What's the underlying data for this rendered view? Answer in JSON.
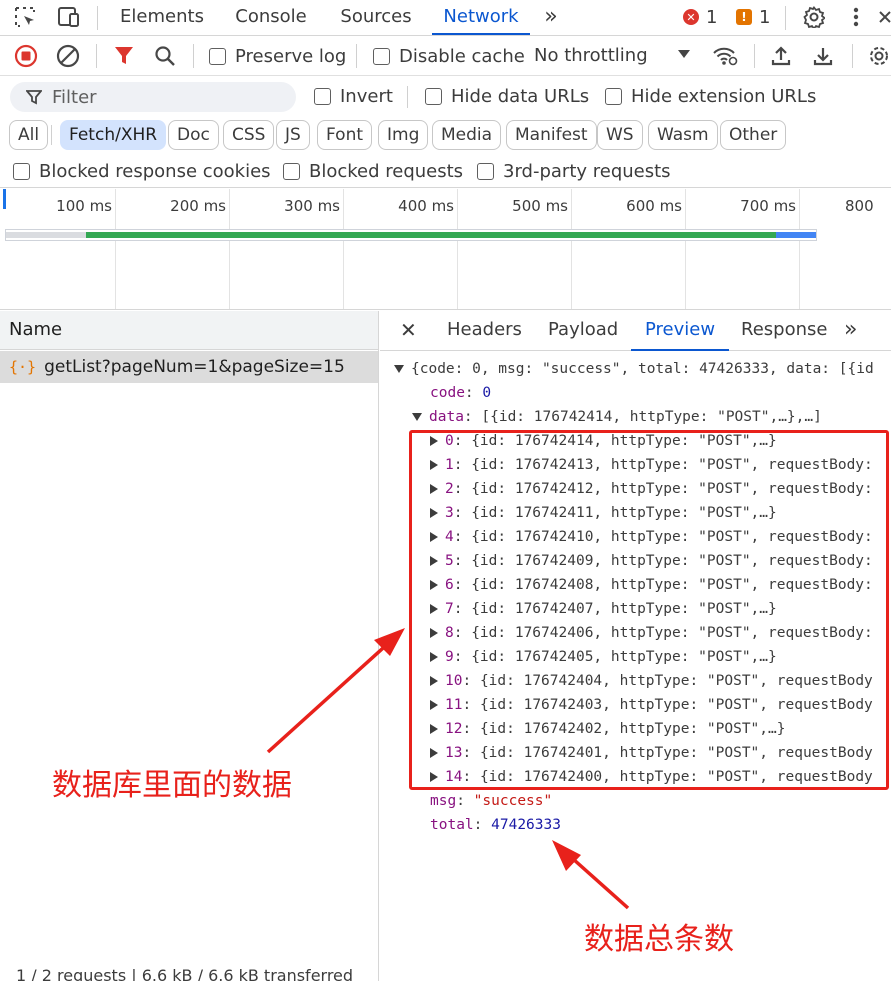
{
  "tabbar": {
    "tabs": [
      "Elements",
      "Console",
      "Sources",
      "Network"
    ],
    "active_tab": "Network",
    "more": "»",
    "errors": "1",
    "warnings": "1"
  },
  "toolbar": {
    "preserve_log": "Preserve log",
    "disable_cache": "Disable cache",
    "throttling": "No throttling"
  },
  "filter": {
    "placeholder": "Filter",
    "invert": "Invert",
    "hide_data_urls": "Hide data URLs",
    "hide_extension_urls": "Hide extension URLs"
  },
  "type_filters": [
    "All",
    "Fetch/XHR",
    "Doc",
    "CSS",
    "JS",
    "Font",
    "Img",
    "Media",
    "Manifest",
    "WS",
    "Wasm",
    "Other"
  ],
  "active_type": "Fetch/XHR",
  "blocked": {
    "cookies": "Blocked response cookies",
    "requests": "Blocked requests",
    "third_party": "3rd-party requests"
  },
  "timeline": {
    "ticks": [
      "100 ms",
      "200 ms",
      "300 ms",
      "400 ms",
      "500 ms",
      "600 ms",
      "700 ms",
      "800"
    ],
    "colors": {
      "waiting": "#34a853",
      "download": "#4285f4",
      "queue": "#dadce0"
    }
  },
  "requests": {
    "header": "Name",
    "rows": [
      {
        "name": "getList?pageNum=1&pageSize=15"
      }
    ],
    "status": "1 / 2 requests | 6.6 kB / 6.6 kB transferred"
  },
  "detail": {
    "close": "✕",
    "tabs": [
      "Headers",
      "Payload",
      "Preview",
      "Response"
    ],
    "active_tab": "Preview",
    "more": "»"
  },
  "preview": {
    "summary": "{code: 0, msg: \"success\", total: 47426333, data: [{id",
    "code_key": "code",
    "code_val": "0",
    "data_key": "data",
    "data_summary": "[{id: 176742414, httpType: \"POST\",…},…]",
    "items": [
      {
        "idx": "0",
        "rest": "{id: 176742414, httpType: \"POST\",…}"
      },
      {
        "idx": "1",
        "rest": "{id: 176742413, httpType: \"POST\", requestBody:"
      },
      {
        "idx": "2",
        "rest": "{id: 176742412, httpType: \"POST\", requestBody:"
      },
      {
        "idx": "3",
        "rest": "{id: 176742411, httpType: \"POST\",…}"
      },
      {
        "idx": "4",
        "rest": "{id: 176742410, httpType: \"POST\", requestBody:"
      },
      {
        "idx": "5",
        "rest": "{id: 176742409, httpType: \"POST\", requestBody:"
      },
      {
        "idx": "6",
        "rest": "{id: 176742408, httpType: \"POST\", requestBody:"
      },
      {
        "idx": "7",
        "rest": "{id: 176742407, httpType: \"POST\",…}"
      },
      {
        "idx": "8",
        "rest": "{id: 176742406, httpType: \"POST\", requestBody:"
      },
      {
        "idx": "9",
        "rest": "{id: 176742405, httpType: \"POST\",…}"
      },
      {
        "idx": "10",
        "rest": "{id: 176742404, httpType: \"POST\", requestBody"
      },
      {
        "idx": "11",
        "rest": "{id: 176742403, httpType: \"POST\", requestBody"
      },
      {
        "idx": "12",
        "rest": "{id: 176742402, httpType: \"POST\",…}"
      },
      {
        "idx": "13",
        "rest": "{id: 176742401, httpType: \"POST\", requestBody"
      },
      {
        "idx": "14",
        "rest": "{id: 176742400, httpType: \"POST\", requestBody"
      }
    ],
    "msg_key": "msg",
    "msg_val": "\"success\"",
    "total_key": "total",
    "total_val": "47426333"
  },
  "annotations": {
    "db_data": "数据库里面的数据",
    "total_count": "数据总条数",
    "color": "#e8211b"
  }
}
